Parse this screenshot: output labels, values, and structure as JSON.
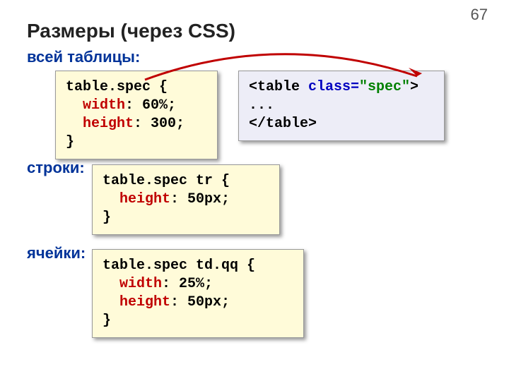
{
  "page_number": "67",
  "title": "Размеры (через CSS)",
  "labels": {
    "table": "всей таблицы:",
    "row": "строки:",
    "cell": "ячейки:"
  },
  "code1": {
    "l1a": "table.spec {",
    "l2a": "  ",
    "l2b": "width",
    "l2c": ": 60%;",
    "l3a": "  ",
    "l3b": "height",
    "l3c": ": 300;",
    "l4a": "}"
  },
  "code2": {
    "l1a": "<table ",
    "l1b": "class=",
    "l1c": "\"spec\"",
    "l1d": ">",
    "l2a": "...",
    "l3a": "</table>"
  },
  "code3": {
    "l1a": "table.spec tr {",
    "l2a": "  ",
    "l2b": "height",
    "l2c": ": 50px;",
    "l3a": "}"
  },
  "code4": {
    "l1a": "table.spec td.qq {",
    "l2a": "  ",
    "l2b": "width",
    "l2c": ": 25%;",
    "l3a": "  ",
    "l3b": "height",
    "l3c": ": 50px;",
    "l4a": "}"
  }
}
